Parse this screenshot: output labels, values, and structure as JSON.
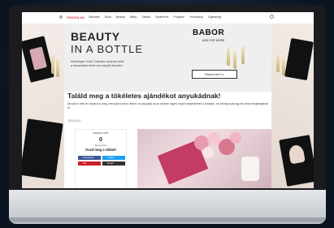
{
  "nav": {
    "logo": "GRAZIA.HU",
    "items": [
      "Stardaet",
      "Divat",
      "Beauty",
      "Baby",
      "Tálalta",
      "Sztárhírek",
      "Program",
      "Horoszkóp",
      "Egészség"
    ]
  },
  "banner": {
    "title": "BEAUTY",
    "subtitle": "IN A BOTTLE",
    "line1": "Különleges Gold Collection ampulla szett",
    "line2": "a fesszesebb bőrért és szépítő álmokért",
    "brand": "BABOR",
    "tag": "ASK FOR MORE",
    "cta": "Fedezd fel!>>>"
  },
  "article": {
    "title": "Találd meg a tökéletes ajándékot anyukádnak!",
    "body": "Mondd el neki és mutasd is meg, mennyire fontos neked: az anyukád és az minden egyes napot megérdemel! a lánddon, és mindig csak egy kis extra megbeptatval ét.",
    "date": "2024.05.05."
  },
  "share": {
    "heading": "Hasznos volt?",
    "count": "0",
    "count_label": "Megosztás",
    "cta": "Oszd meg a cikket!",
    "buttons": [
      {
        "label": "Facebook",
        "color": "#3b5998"
      },
      {
        "label": "Twitter",
        "color": "#1da1f2"
      },
      {
        "label": "Pin",
        "color": "#cb2027"
      },
      {
        "label": "Email",
        "color": "#333333"
      }
    ]
  }
}
